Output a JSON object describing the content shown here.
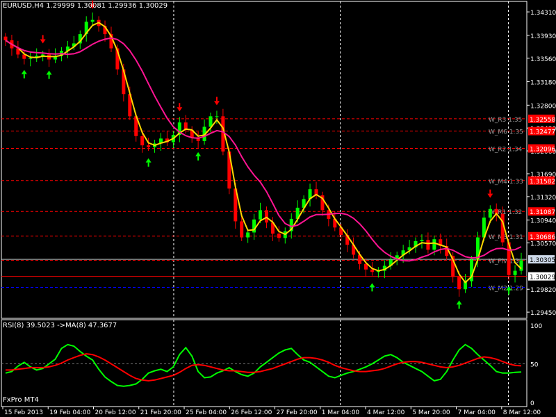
{
  "header": {
    "title": "EURUSD,H4  1.29999 1.30081 1.29936 1.30029",
    "rsi_label": "RSI(8) 39.5023  ->MA(8) 47.3677",
    "brand": "FxPro MT4"
  },
  "colors": {
    "background": "#000000",
    "frame": "#ffffff",
    "bull": "#00ff00",
    "bear": "#ff0000",
    "ma_fast": "#ffd700",
    "ma_slow": "#ff1493",
    "level_dash": "#ff0000",
    "current_line": "#c0c0c0",
    "blue_line": "#0000ff",
    "rsi_line": "#00ff00",
    "rsi_ma": "#ff0000"
  },
  "chart_data": [
    {
      "type": "candlestick",
      "symbol": "EURUSD",
      "timeframe": "H4",
      "ohlc": {
        "open": 1.29999,
        "high": 1.30081,
        "low": 1.29936,
        "close": 1.30029
      },
      "x_labels": [
        "15 Feb 2013",
        "19 Feb 04:00",
        "20 Feb 12:00",
        "21 Feb 20:00",
        "25 Feb 04:00",
        "26 Feb 12:00",
        "27 Feb 20:00",
        "1 Mar 04:00",
        "4 Mar 12:00",
        "5 Mar 20:00",
        "7 Mar 04:00",
        "8 Mar 12:00"
      ],
      "y_ticks": [
        1.3431,
        1.3393,
        1.3356,
        1.3318,
        1.328,
        1.3243,
        1.3206,
        1.3169,
        1.3132,
        1.3094,
        1.3057,
        1.2982,
        1.2945
      ],
      "ylim": [
        1.2935,
        1.3448
      ],
      "closes": [
        1.3385,
        1.3372,
        1.3362,
        1.3355,
        1.3356,
        1.336,
        1.3362,
        1.3354,
        1.336,
        1.3368,
        1.3375,
        1.338,
        1.3395,
        1.3415,
        1.3418,
        1.3408,
        1.3395,
        1.3372,
        1.3338,
        1.3298,
        1.3262,
        1.323,
        1.3215,
        1.3212,
        1.3218,
        1.3226,
        1.322,
        1.3232,
        1.3252,
        1.324,
        1.3228,
        1.3222,
        1.3245,
        1.3262,
        1.3262,
        1.3205,
        1.3145,
        1.3092,
        1.3066,
        1.3074,
        1.3095,
        1.311,
        1.309,
        1.3072,
        1.3065,
        1.3076,
        1.3096,
        1.3114,
        1.3128,
        1.3144,
        1.3134,
        1.311,
        1.3096,
        1.3082,
        1.307,
        1.3054,
        1.3038,
        1.3023,
        1.3014,
        1.301,
        1.3012,
        1.302,
        1.303,
        1.3037,
        1.3045,
        1.305,
        1.306,
        1.3062,
        1.3046,
        1.3063,
        1.3052,
        1.3036,
        1.3002,
        1.2982,
        1.2995,
        1.303,
        1.3066,
        1.3098,
        1.3112,
        1.3104,
        1.3058,
        1.3005,
        1.3012,
        1.3029
      ],
      "levels": [
        {
          "label": "W_R3 1.35",
          "value": 1.3258
        },
        {
          "label": "W_M6 1.35",
          "value": 1.3238
        },
        {
          "label": "W_R2 1.34",
          "value": 1.321
        },
        {
          "label": "W_M4 1.33",
          "value": 1.3158
        },
        {
          "label": "W_R1 1.32",
          "value": 1.3108
        },
        {
          "label": "W_M3 1.31",
          "value": 1.3068
        },
        {
          "label": "W_Piv 1.3",
          "value": 1.3029
        },
        {
          "label": "W_M2 1.29",
          "value": 1.2985
        }
      ],
      "level_tags": [
        "1.32558",
        "1.32477",
        "1.32096",
        "1.31582",
        "1.31087",
        "1.30686"
      ],
      "current_prices": [
        {
          "label": "1.30305",
          "value": 1.30305
        },
        {
          "label": "1.30029",
          "value": 1.30029
        }
      ],
      "series": [
        {
          "name": "",
          "role": "fast moving average",
          "smoothing": 3
        },
        {
          "name": "",
          "role": "slow moving average",
          "smoothing": 10
        }
      ]
    },
    {
      "type": "line",
      "title": "RSI(8) 39.5023  ->MA(8) 47.3677",
      "ylim": [
        0,
        100
      ],
      "y_ticks": [
        "100",
        "50",
        "0"
      ],
      "series": [
        {
          "name": "RSI(8)",
          "values": [
            38,
            40,
            47,
            52,
            46,
            42,
            44,
            50,
            56,
            70,
            75,
            73,
            66,
            60,
            55,
            43,
            33,
            27,
            22,
            21,
            22,
            24,
            30,
            38,
            41,
            43,
            40,
            46,
            62,
            71,
            60,
            40,
            32,
            33,
            38,
            41,
            45,
            40,
            36,
            34,
            38,
            46,
            52,
            58,
            64,
            68,
            70,
            62,
            55,
            52,
            46,
            40,
            34,
            32,
            35,
            38,
            40,
            43,
            46,
            50,
            55,
            60,
            62,
            58,
            52,
            48,
            44,
            40,
            34,
            28,
            30,
            40,
            55,
            68,
            75,
            70,
            62,
            55,
            48,
            40,
            38,
            38,
            39,
            39.5
          ]
        },
        {
          "name": "MA(8)",
          "values": [
            42,
            42,
            43,
            44,
            45,
            45,
            45,
            46,
            48,
            51,
            55,
            58,
            61,
            63,
            62,
            59,
            55,
            50,
            45,
            40,
            35,
            31,
            29,
            28,
            29,
            31,
            33,
            35,
            39,
            44,
            48,
            49,
            48,
            46,
            44,
            42,
            41,
            41,
            40,
            39,
            39,
            40,
            42,
            44,
            47,
            50,
            53,
            56,
            58,
            58,
            57,
            55,
            52,
            48,
            45,
            43,
            41,
            40,
            40,
            41,
            42,
            44,
            47,
            50,
            52,
            53,
            53,
            52,
            50,
            48,
            46,
            45,
            46,
            48,
            51,
            54,
            57,
            59,
            58,
            56,
            53,
            50,
            48,
            47.3677
          ]
        }
      ]
    }
  ]
}
